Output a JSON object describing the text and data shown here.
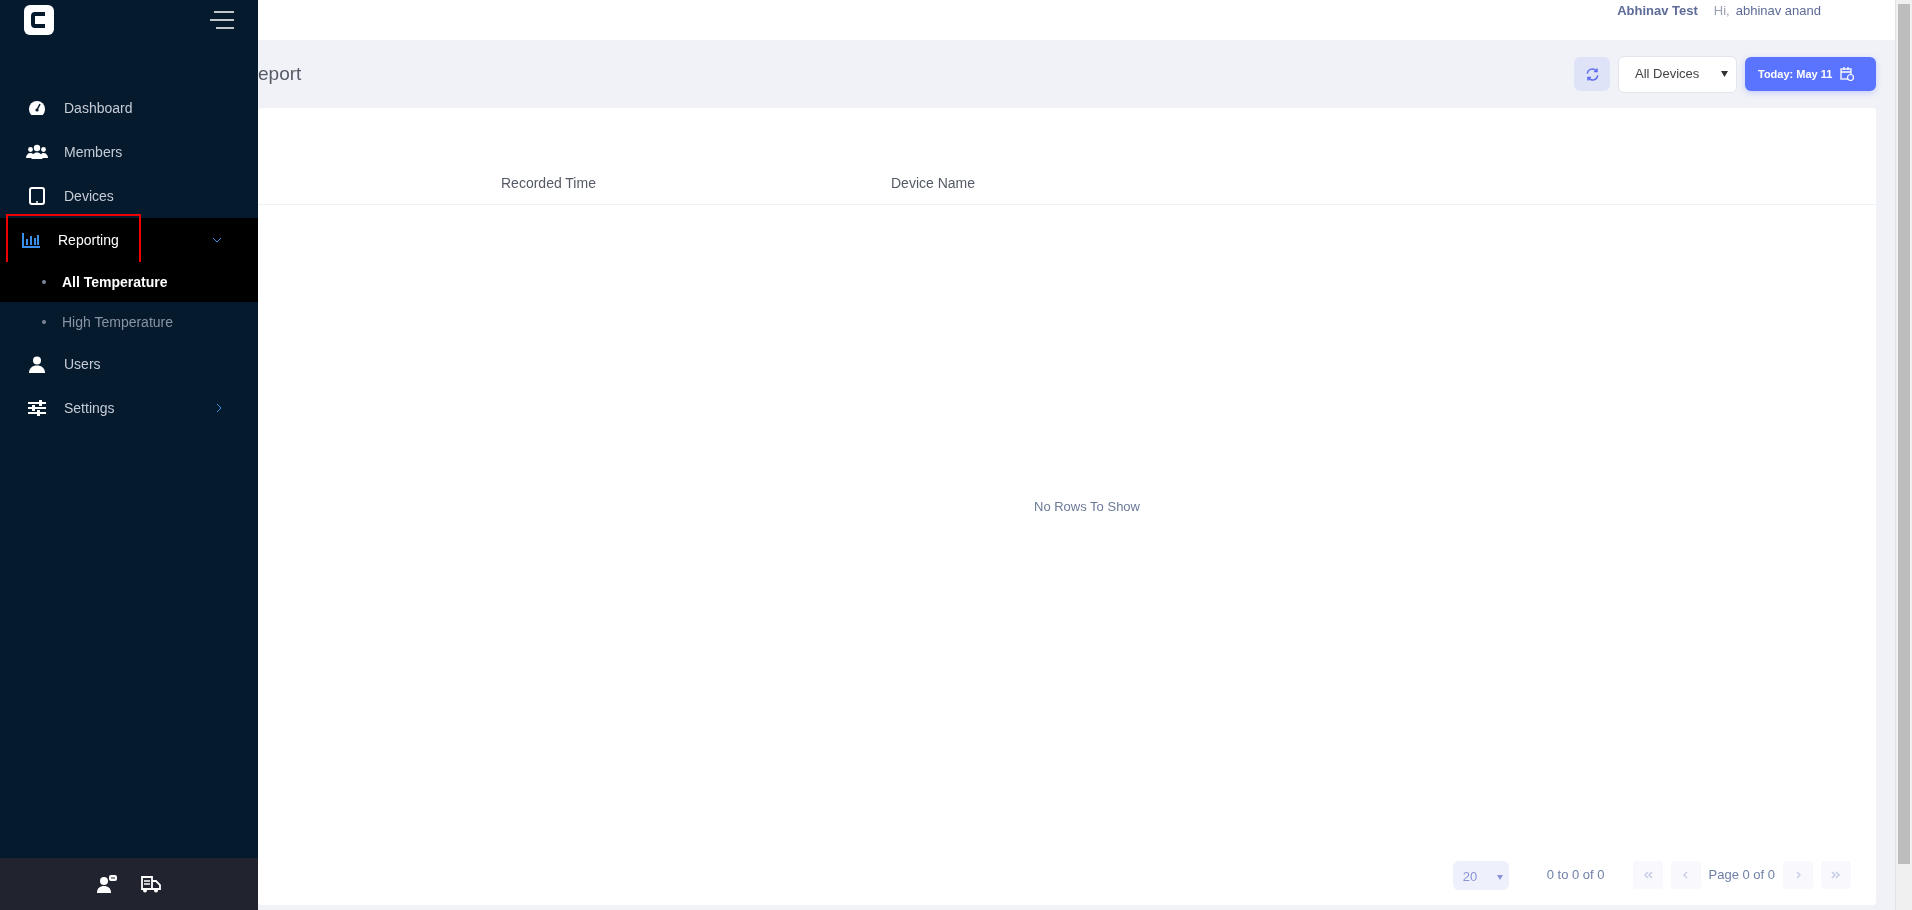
{
  "sidebar": {
    "menu": [
      {
        "label": "Dashboard",
        "selected": false,
        "highlighted": false
      },
      {
        "label": "Members",
        "selected": false,
        "highlighted": false
      },
      {
        "label": "Devices",
        "selected": false,
        "highlighted": false
      },
      {
        "label": "Reporting",
        "selected": true,
        "highlighted": true,
        "expanded": true,
        "children": [
          {
            "label": "All Temperature",
            "selected": true
          },
          {
            "label": "High Temperature",
            "selected": false
          }
        ]
      },
      {
        "label": "Users",
        "selected": false,
        "highlighted": false
      },
      {
        "label": "Settings",
        "selected": false,
        "highlighted": false,
        "expanded": false
      }
    ]
  },
  "header": {
    "company": "Abhinav Test",
    "greeting": "Hi,",
    "user": "abhinav anand"
  },
  "page": {
    "title": "eport",
    "device_filter": "All Devices",
    "date_button": "Today: May 11"
  },
  "table": {
    "columns": [
      "Recorded Time",
      "Device Name"
    ],
    "empty_message": "No Rows To Show"
  },
  "pagination": {
    "page_size": "20",
    "range": "0 to 0 of 0",
    "page": "Page 0 of 0",
    "first_disabled": true,
    "prev_disabled": true,
    "next_disabled": true,
    "last_disabled": true
  }
}
